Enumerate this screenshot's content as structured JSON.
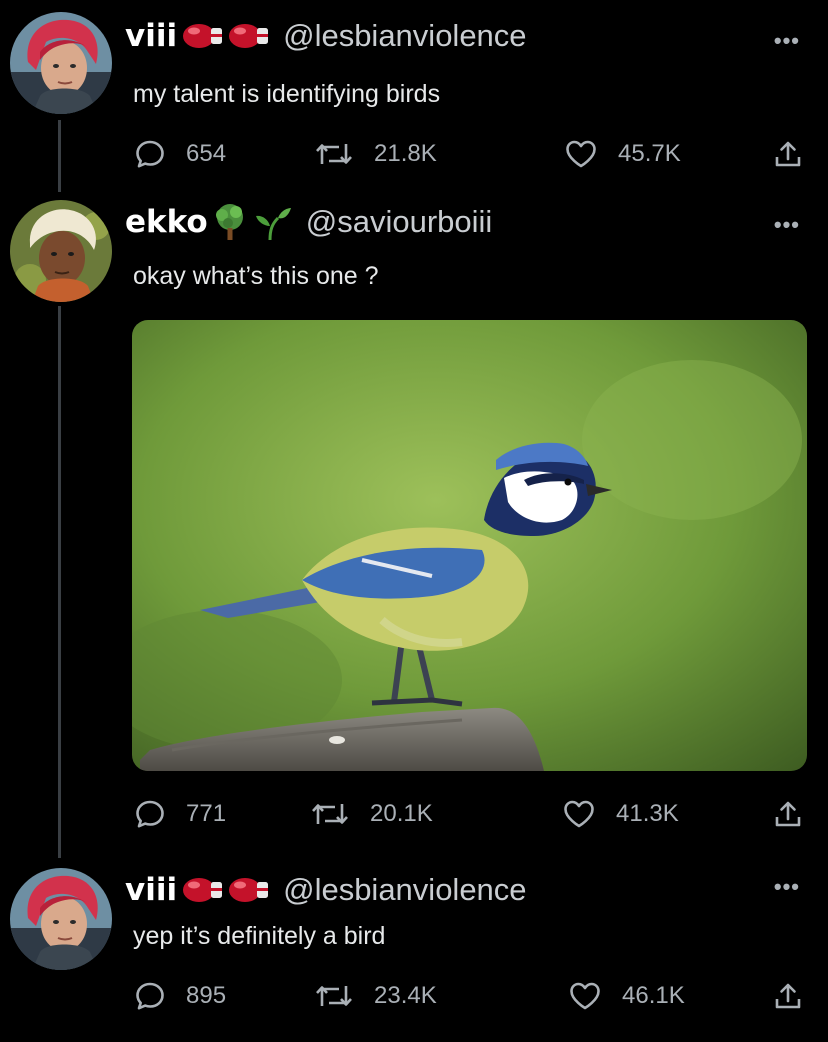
{
  "tweets": [
    {
      "name": "viii",
      "name_emoji": [
        "boxing-glove-icon",
        "boxing-glove-icon"
      ],
      "handle": "@lesbianviolence",
      "text": "my talent is identifying birds",
      "more": "•••",
      "replies": "654",
      "retweets": "21.8K",
      "likes": "45.7K"
    },
    {
      "name": "ekko",
      "name_emoji": [
        "tree-icon",
        "seedling-icon"
      ],
      "handle": "@saviourboiii",
      "text": "okay what’s this one ?",
      "more": "•••",
      "replies": "771",
      "retweets": "20.1K",
      "likes": "41.3K"
    },
    {
      "name": "viii",
      "name_emoji": [
        "boxing-glove-icon",
        "boxing-glove-icon"
      ],
      "handle": "@lesbianviolence",
      "text": "yep it’s definitely a bird",
      "more": "•••",
      "replies": "895",
      "retweets": "23.4K",
      "likes": "46.1K"
    }
  ],
  "colors": {
    "background": "#000000",
    "text": "#e7e9ea",
    "muted": "#aab0b6",
    "thread_line": "#3a3f44"
  }
}
